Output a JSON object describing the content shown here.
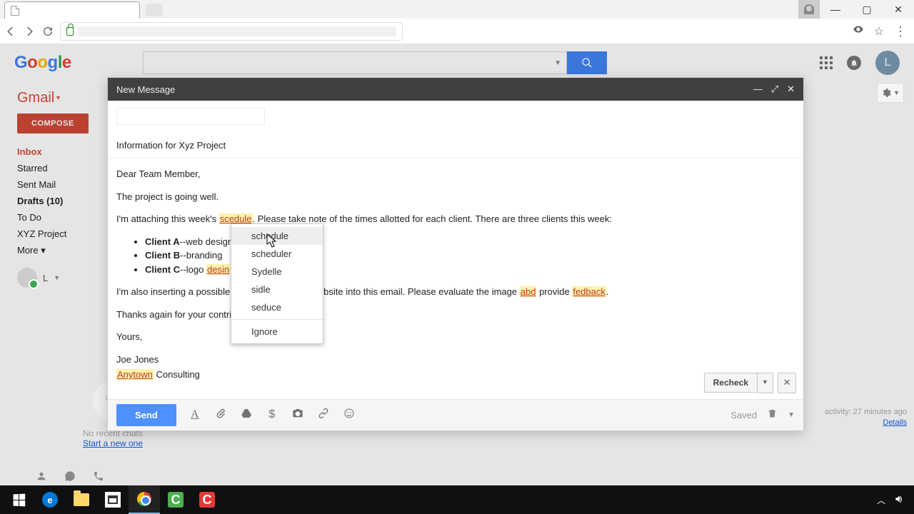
{
  "chrome": {
    "tab_title": ""
  },
  "google": {
    "letters": [
      "G",
      "o",
      "o",
      "g",
      "l",
      "e"
    ]
  },
  "gmail": {
    "label": "Gmail",
    "compose": "COMPOSE",
    "nav": {
      "inbox": "Inbox",
      "starred": "Starred",
      "sent": "Sent Mail",
      "drafts": "Drafts (10)",
      "todo": "To Do",
      "xyz": "XYZ Project",
      "more": "More"
    },
    "user_initial": "L",
    "hangouts_empty_1": "No recent chats",
    "hangouts_empty_2": "Start a new one",
    "activity_line": "activity: 27 minutes ago",
    "activity_details": "Details"
  },
  "compose": {
    "title": "New Message",
    "subject": "Information for Xyz Project",
    "body": {
      "greeting": "Dear Team Member,",
      "p1": "The project is going well.",
      "p2_a": "I'm attaching this week's ",
      "p2_err": "scedule",
      "p2_b": ". Please take note of the times allotted for each client. There are three clients this week:",
      "li1_bold": "Client A",
      "li1_rest": "--web design",
      "li2_bold": "Client B",
      "li2_rest": "--branding",
      "li3_bold": "Client C",
      "li3_rest": "--logo ",
      "li3_err": "desin",
      "p3_a": "I'm also inserting a possible ",
      "p3_gap": "",
      "p3_b": "ebsite into this email. Please evaluate the image ",
      "p3_err1": "abd",
      "p3_c": " provide ",
      "p3_err2": "fedback",
      "p3_d": ".",
      "p4": "Thanks again for your contrib",
      "closing": "Yours,",
      "sig1": "Joe Jones",
      "sig2_err": "Anytown",
      "sig2_rest": " Consulting"
    },
    "recheck": "Recheck",
    "send": "Send",
    "saved": "Saved"
  },
  "spellmenu": {
    "s1": "schedule",
    "s2": "scheduler",
    "s3": "Sydelle",
    "s4": "sidle",
    "s5": "seduce",
    "ignore": "Ignore"
  },
  "avatar_letter": "L"
}
